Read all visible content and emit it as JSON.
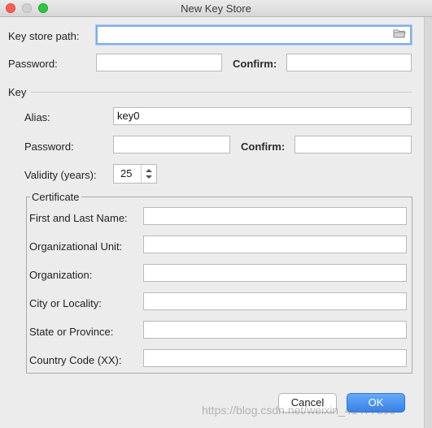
{
  "window": {
    "title": "New Key Store"
  },
  "keystore": {
    "path_label": "Key store path:",
    "path_value": "",
    "password_label": "Password:",
    "password_value": "",
    "confirm_label": "Confirm:",
    "confirm_value": ""
  },
  "key": {
    "section_label": "Key",
    "alias_label": "Alias:",
    "alias_value": "key0",
    "password_label": "Password:",
    "password_value": "",
    "confirm_label": "Confirm:",
    "confirm_value": "",
    "validity_label": "Validity (years):",
    "validity_value": "25"
  },
  "certificate": {
    "legend": "Certificate",
    "fields": [
      {
        "label": "First and Last Name:",
        "value": ""
      },
      {
        "label": "Organizational Unit:",
        "value": ""
      },
      {
        "label": "Organization:",
        "value": ""
      },
      {
        "label": "City or Locality:",
        "value": ""
      },
      {
        "label": "State or Province:",
        "value": ""
      },
      {
        "label": "Country Code (XX):",
        "value": ""
      }
    ]
  },
  "buttons": {
    "cancel": "Cancel",
    "ok": "OK"
  },
  "watermark": "https://blog.csdn.net/weixin_41477306",
  "icons": {
    "browse": "folder-icon",
    "spinner": "spinner-arrows-icon"
  },
  "colors": {
    "accent": "#2f82ef",
    "focus_ring": "#7faee8",
    "close": "#fc5f57",
    "maximize": "#2ac840"
  }
}
